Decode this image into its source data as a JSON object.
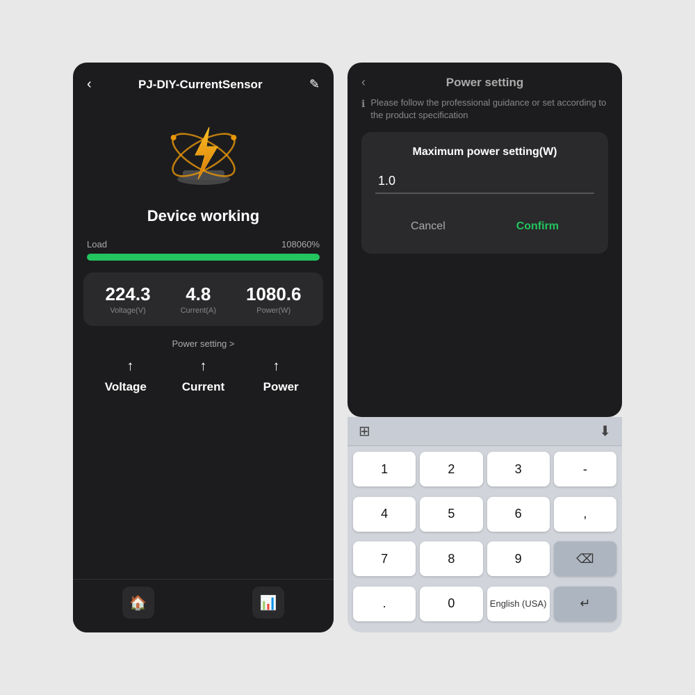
{
  "left": {
    "back_label": "‹",
    "title": "PJ-DIY-CurrentSensor",
    "edit_icon": "✎",
    "device_status": "Device working",
    "load_label": "Load",
    "load_percent": "108060%",
    "voltage_value": "224.3",
    "voltage_unit": "Voltage(V)",
    "current_value": "4.8",
    "current_unit": "Current(A)",
    "power_value": "1080.6",
    "power_unit": "Power(W)",
    "power_setting_link": "Power setting >",
    "label_voltage": "Voltage",
    "label_current": "Current",
    "label_power": "Power",
    "nav_home_icon": "⌂",
    "nav_chart_icon": "📊"
  },
  "right": {
    "back_label": "‹",
    "title": "Power setting",
    "info_text": "Please follow the professional guidance or set according to the product specification",
    "dialog": {
      "title": "Maximum power setting(W)",
      "input_value": "1.0",
      "cancel_label": "Cancel",
      "confirm_label": "Confirm"
    },
    "keyboard": {
      "toolbar_left_icon": "⊞",
      "toolbar_right_icon": "⬇",
      "keys": [
        {
          "label": "1",
          "type": "normal"
        },
        {
          "label": "2",
          "type": "normal"
        },
        {
          "label": "3",
          "type": "normal"
        },
        {
          "label": "-",
          "type": "normal"
        },
        {
          "label": "4",
          "type": "normal"
        },
        {
          "label": "5",
          "type": "normal"
        },
        {
          "label": "6",
          "type": "normal"
        },
        {
          "label": ",",
          "type": "normal"
        },
        {
          "label": "7",
          "type": "normal"
        },
        {
          "label": "8",
          "type": "normal"
        },
        {
          "label": "9",
          "type": "normal"
        },
        {
          "label": "⌫",
          "type": "special"
        },
        {
          "label": ".",
          "type": "normal"
        },
        {
          "label": "0",
          "type": "normal"
        },
        {
          "label": "English (USA)",
          "type": "wide"
        },
        {
          "label": "↵",
          "type": "special"
        }
      ]
    }
  }
}
